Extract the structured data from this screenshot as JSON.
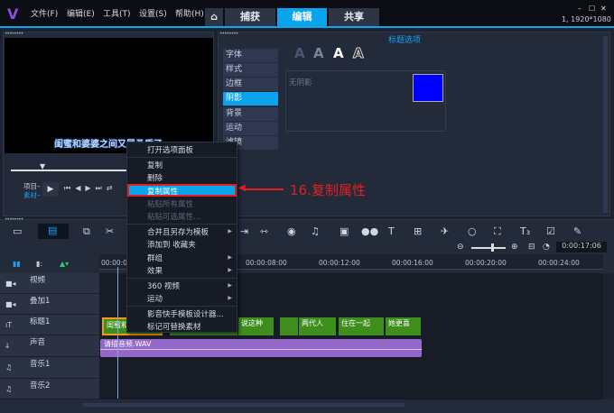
{
  "menubar": {
    "items": [
      "文件(F)",
      "编辑(E)",
      "工具(T)",
      "设置(S)",
      "帮助(H)"
    ]
  },
  "tabs": [
    {
      "label": "捕获"
    },
    {
      "label": "编辑"
    },
    {
      "label": "共享"
    }
  ],
  "window": {
    "resolution": "1, 1920*1080",
    "minimize": "–",
    "maximize": "☐",
    "close": "✕"
  },
  "preview": {
    "subtitle": "闺蜜和婆婆之间又冒矛盾了",
    "mode_project": "项目–",
    "mode_clip": "素材–"
  },
  "title_options": {
    "heading": "标题选项",
    "side_tabs": [
      "字体",
      "样式",
      "边框",
      "阴影",
      "背景",
      "运动",
      "滤镜"
    ],
    "active_tab": "阴影",
    "shadow_label": "无阴影",
    "shadow_color": "#0000ff",
    "presets": [
      "A",
      "A",
      "A",
      "A"
    ]
  },
  "context_menu": {
    "items": [
      {
        "label": "打开选项面板",
        "disabled": false
      },
      {
        "label": "复制",
        "disabled": false
      },
      {
        "label": "删除",
        "disabled": false
      },
      {
        "label": "复制属性",
        "disabled": false,
        "highlighted": true
      },
      {
        "label": "粘贴所有属性",
        "disabled": true
      },
      {
        "label": "粘贴可选属性...",
        "disabled": true
      },
      {
        "label": "合并且另存为模板",
        "submenu": true
      },
      {
        "label": "添加到 收藏夹"
      },
      {
        "label": "群组",
        "submenu": true
      },
      {
        "label": "效果",
        "submenu": true
      },
      {
        "label": "360 视频",
        "submenu": true
      },
      {
        "label": "运动",
        "submenu": true
      },
      {
        "label": "影音快手模板设计器..."
      },
      {
        "label": "标记可替换素材"
      }
    ]
  },
  "annotation": {
    "text": "16.复制属性",
    "color": "#e02020"
  },
  "timeline": {
    "timecode": "0:00:17:06",
    "ruler": [
      "00:00:00",
      "00:00:08:00",
      "00:00:12:00",
      "00:00:16:00",
      "00:00:20:00",
      "00:00:24:00"
    ],
    "tracks": [
      "视频",
      "叠加1",
      "标题1",
      "声音",
      "音乐1",
      "音乐2"
    ],
    "title_clips": [
      "闺蜜和",
      "",
      "说这种",
      "",
      "两代人",
      "住在一起",
      "她更喜"
    ],
    "audio_clip": "请描音频.WAV"
  }
}
